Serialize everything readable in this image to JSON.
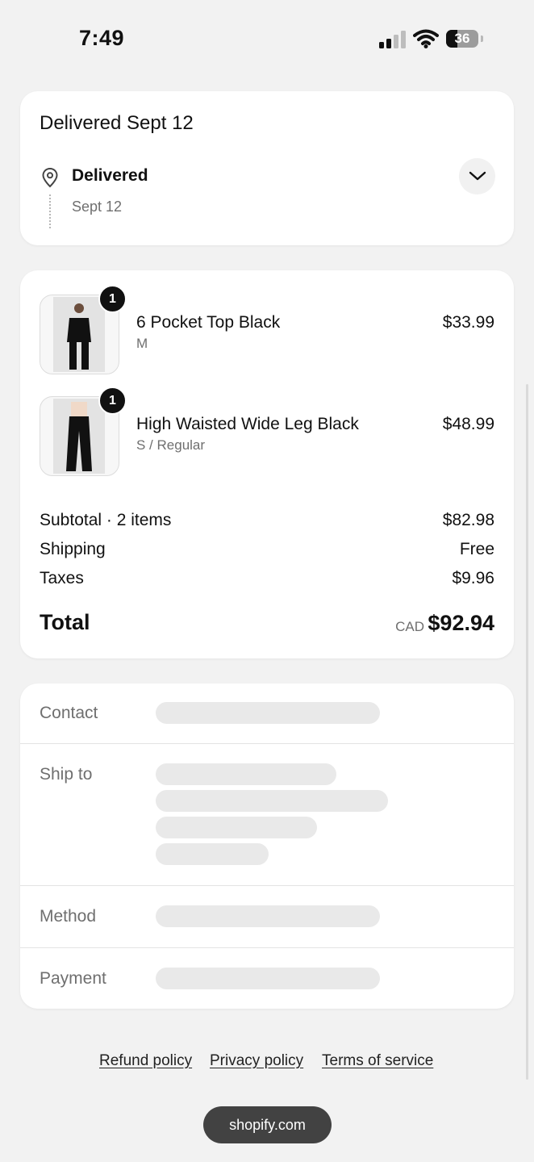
{
  "status_bar": {
    "time": "7:49",
    "battery": "36",
    "battery_level_percent": 36
  },
  "delivery": {
    "title": "Delivered Sept 12",
    "status": "Delivered",
    "date": "Sept 12",
    "icons": {
      "location": "map-pin-icon",
      "expand": "chevron-down-icon"
    }
  },
  "order": {
    "items": [
      {
        "name": "6 Pocket Top Black",
        "variant": "M",
        "price": "$33.99",
        "quantity": "1"
      },
      {
        "name": "High Waisted Wide Leg Black",
        "variant": "S / Regular",
        "price": "$48.99",
        "quantity": "1"
      }
    ],
    "summary": [
      {
        "label": "Subtotal · 2 items",
        "value": "$82.98"
      },
      {
        "label": "Shipping",
        "value": "Free"
      },
      {
        "label": "Taxes",
        "value": "$9.96"
      }
    ],
    "total_label": "Total",
    "currency": "CAD",
    "total": "$92.94"
  },
  "info": {
    "contact_label": "Contact",
    "ship_to_label": "Ship to",
    "method_label": "Method",
    "payment_label": "Payment"
  },
  "footer": {
    "links": [
      "Refund policy",
      "Privacy policy",
      "Terms of service"
    ],
    "domain": "shopify.com"
  }
}
